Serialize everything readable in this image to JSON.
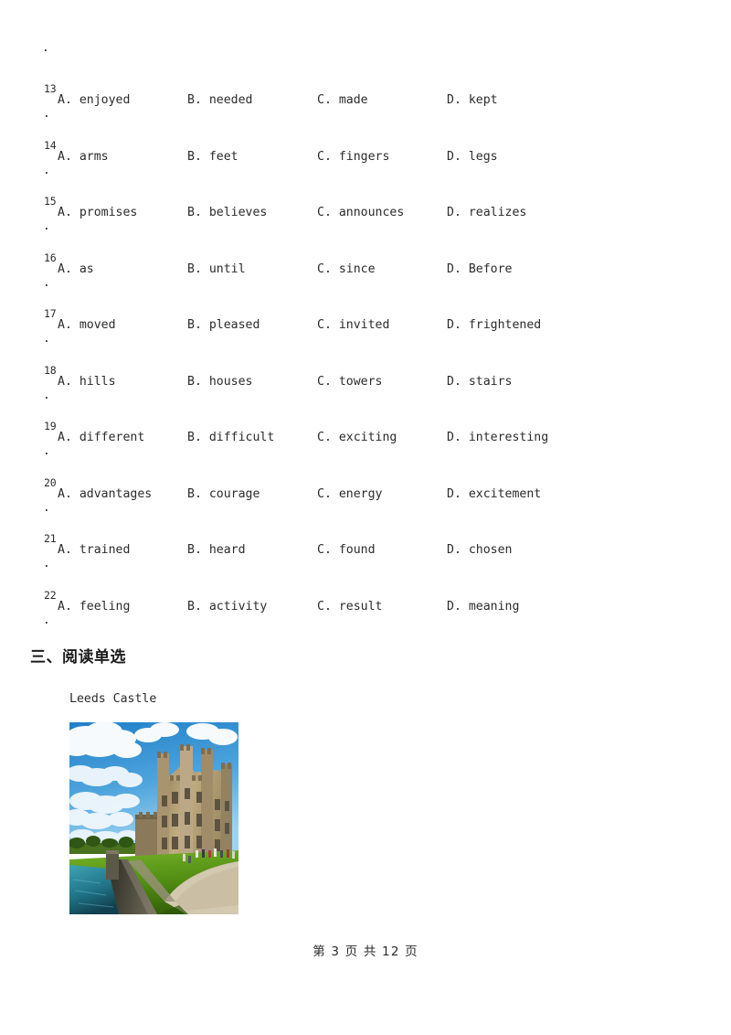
{
  "document": {
    "orphan_dot": ".",
    "section_heading": "三、阅读单选",
    "passage_title": "Leeds Castle",
    "footer": "第 3 页 共 12 页"
  },
  "questions": [
    {
      "number": "13",
      "dot": ".",
      "options": {
        "a": "A. enjoyed",
        "b": "B. needed",
        "c": "C. made",
        "d": "D. kept"
      }
    },
    {
      "number": "14",
      "dot": ".",
      "options": {
        "a": "A. arms",
        "b": "B. feet",
        "c": "C. fingers",
        "d": "D. legs"
      }
    },
    {
      "number": "15",
      "dot": ".",
      "options": {
        "a": "A. promises",
        "b": "B. believes",
        "c": "C. announces",
        "d": "D. realizes"
      }
    },
    {
      "number": "16",
      "dot": ".",
      "options": {
        "a": "A. as",
        "b": "B. until",
        "c": "C. since",
        "d": "D. Before"
      }
    },
    {
      "number": "17",
      "dot": ".",
      "options": {
        "a": "A. moved",
        "b": "B. pleased",
        "c": "C. invited",
        "d": "D. frightened"
      }
    },
    {
      "number": "18",
      "dot": ".",
      "options": {
        "a": "A. hills",
        "b": "B. houses",
        "c": "C. towers",
        "d": "D. stairs"
      }
    },
    {
      "number": "19",
      "dot": ".",
      "options": {
        "a": "A. different",
        "b": "B. difficult",
        "c": "C. exciting",
        "d": "D. interesting"
      }
    },
    {
      "number": "20",
      "dot": ".",
      "options": {
        "a": "A. advantages",
        "b": "B. courage",
        "c": "C. energy",
        "d": "D. excitement"
      }
    },
    {
      "number": "21",
      "dot": ".",
      "options": {
        "a": "A. trained",
        "b": "B. heard",
        "c": "C. found",
        "d": "D. chosen"
      }
    },
    {
      "number": "22",
      "dot": ".",
      "options": {
        "a": "A. feeling",
        "b": "B. activity",
        "c": "C. result",
        "d": "D. meaning"
      }
    }
  ],
  "photo": {
    "subject": "Leeds Castle",
    "colors": {
      "sky_top": "#2f8fd4",
      "sky_bottom": "#8ecdf0",
      "cloud": "#fdfdfd",
      "stone_light": "#c9b184",
      "stone_mid": "#a38f68",
      "stone_dark": "#6d604a",
      "lawn": "#4f8b12",
      "lawn_light": "#74ad27",
      "water": "#2e8ba0",
      "path": "#cfc6ae",
      "wall_shadow": "#3b3a32"
    }
  }
}
